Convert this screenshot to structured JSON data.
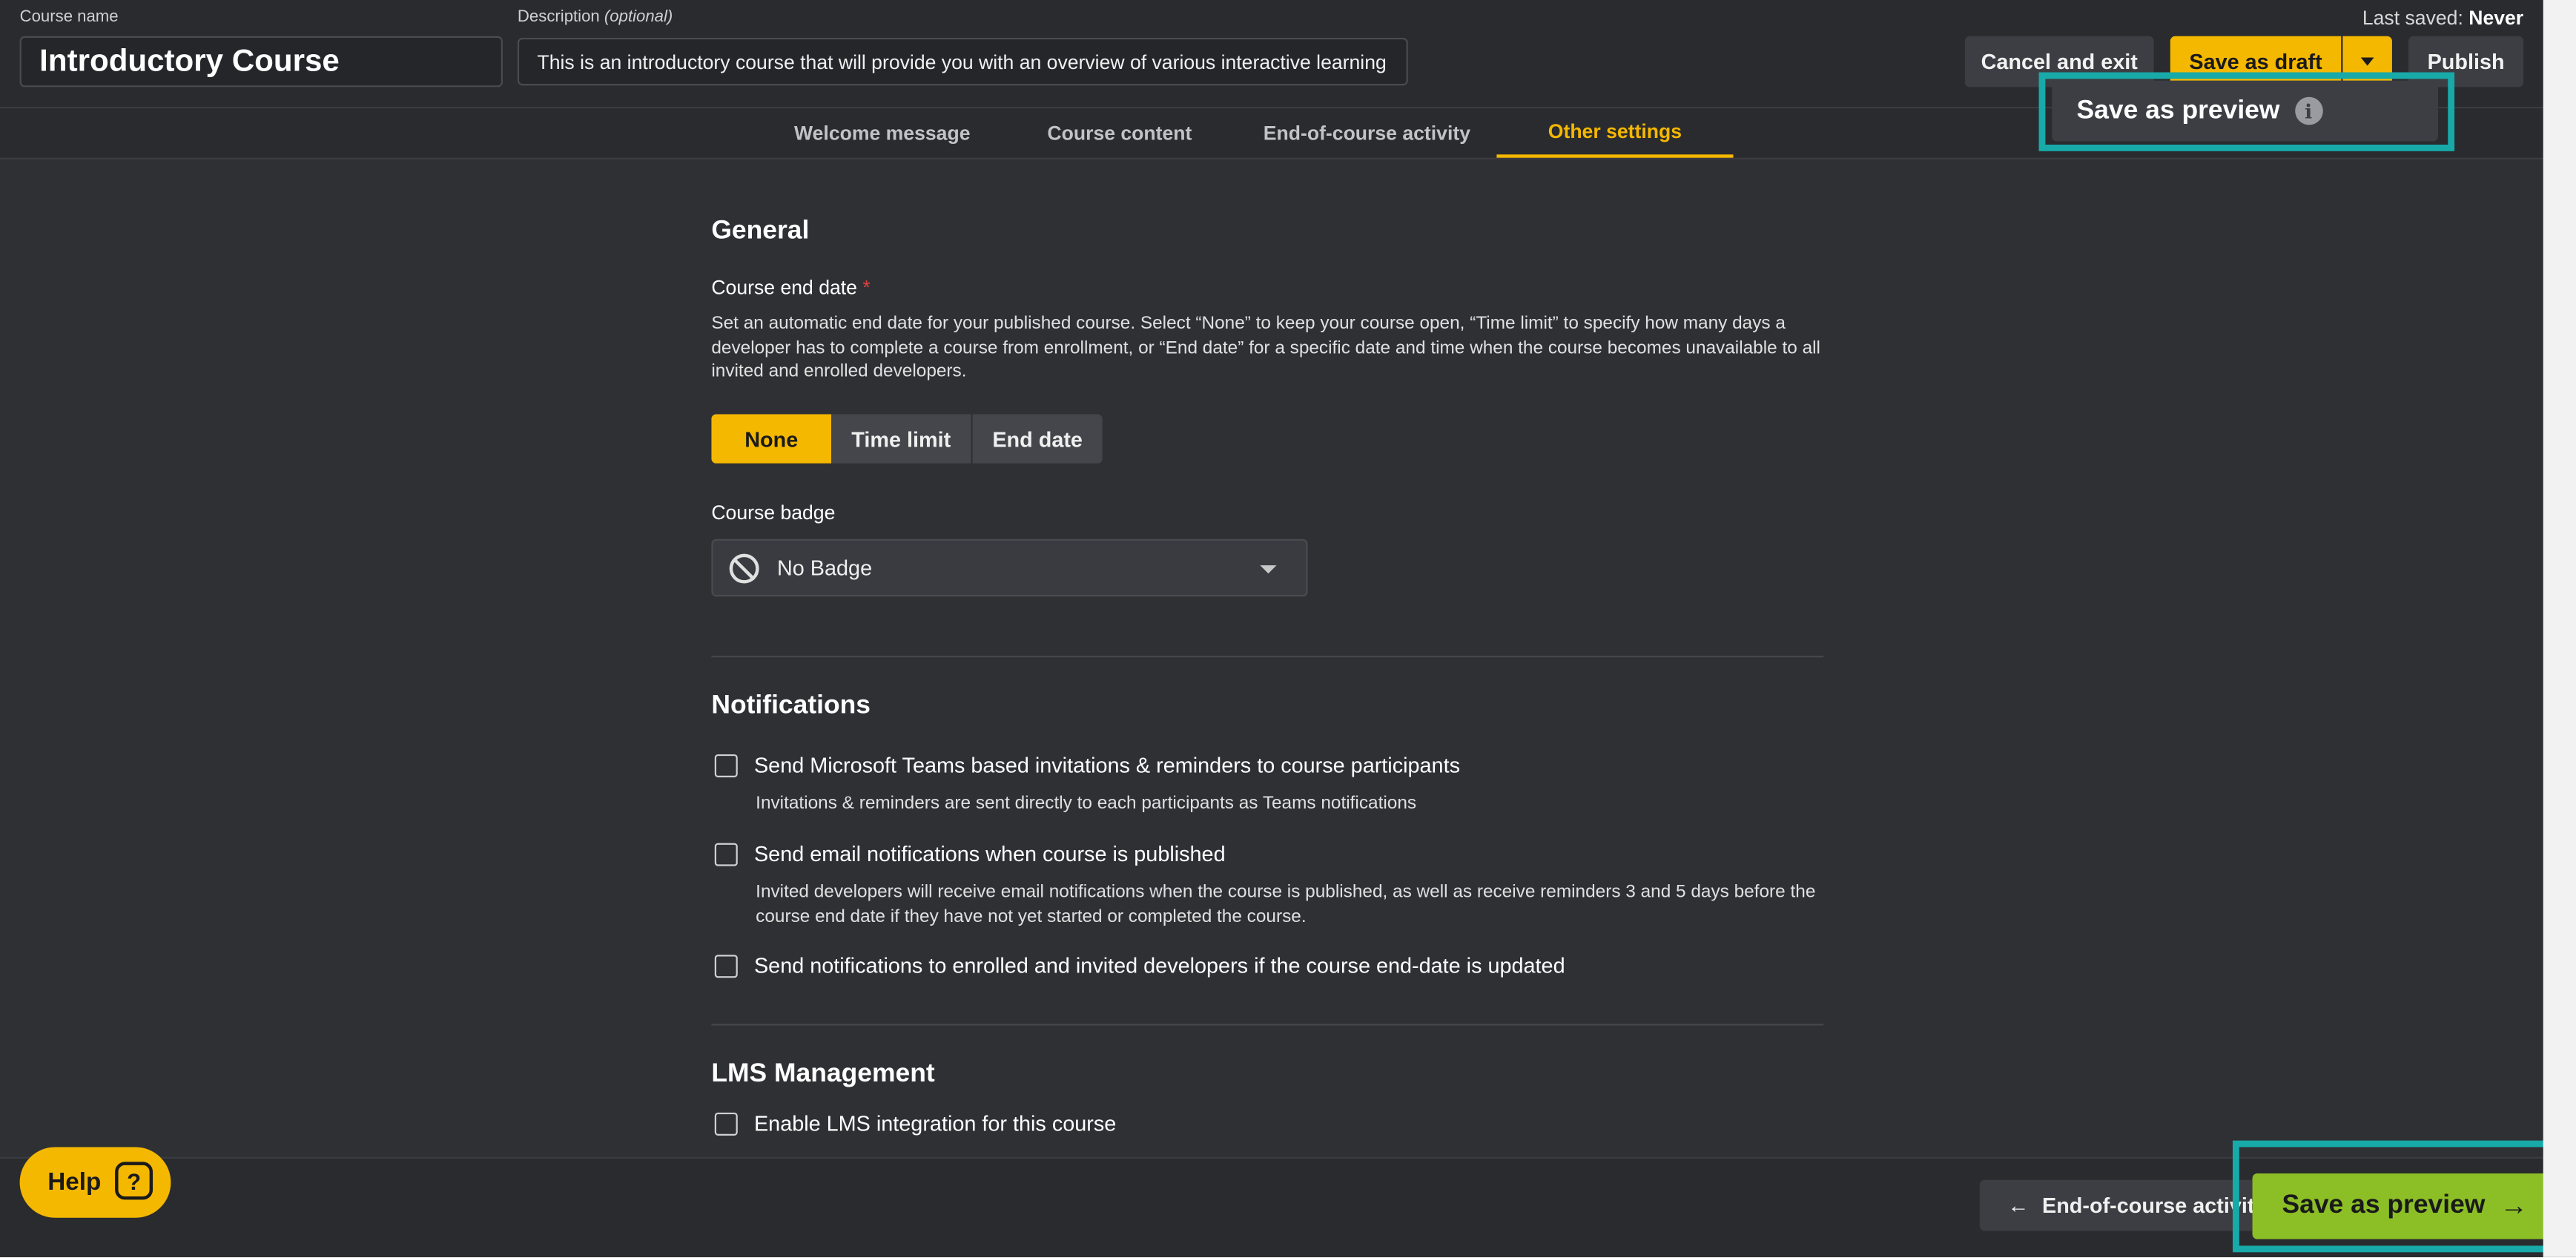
{
  "header": {
    "course_name_label": "Course name",
    "course_name_value": "Introductory Course",
    "description_label": "Description",
    "description_optional": "(optional)",
    "description_value": "This is an introductory course that will provide you with an overview of various interactive learning",
    "last_saved_label": "Last saved:",
    "last_saved_value": "Never",
    "cancel_label": "Cancel and exit",
    "save_draft_label": "Save as draft",
    "publish_label": "Publish",
    "dropdown_item_label": "Save as preview",
    "info_glyph": "i"
  },
  "tabs": [
    {
      "label": "Welcome message"
    },
    {
      "label": "Course content"
    },
    {
      "label": "End-of-course activity"
    },
    {
      "label": "Other settings"
    }
  ],
  "general": {
    "heading": "General",
    "end_date_label": "Course end date",
    "required_mark": "*",
    "end_date_help": "Set an automatic end date for your published course. Select “None” to keep your course open, “Time limit” to specify how many days a developer has to complete a course from enrollment, or “End date” for a specific date and time when the course becomes unavailable to all invited and enrolled developers.",
    "options": [
      "None",
      "Time limit",
      "End date"
    ],
    "badge_label": "Course badge",
    "badge_value": "No Badge"
  },
  "notifications": {
    "heading": "Notifications",
    "items": [
      {
        "label": "Send Microsoft Teams based invitations & reminders to course participants",
        "help": "Invitations & reminders are sent directly to each participants as Teams notifications"
      },
      {
        "label": "Send email notifications when course is published",
        "help": "Invited developers will receive email notifications when the course is published, as well as receive reminders 3 and 5 days before the course end date if they have not yet started or completed the course."
      },
      {
        "label": "Send notifications to enrolled and invited developers if the course end-date is updated",
        "help": ""
      }
    ]
  },
  "lms": {
    "heading": "LMS Management",
    "enable_label": "Enable LMS integration for this course"
  },
  "footer": {
    "help_label": "Help",
    "help_glyph": "?",
    "back_label": "End-of-course activity",
    "back_glyph": "←",
    "preview_label": "Save as preview",
    "preview_glyph": "→"
  },
  "colors": {
    "accent": "#f5b800",
    "preview_green": "#8cbf26",
    "highlight": "#18a9a9"
  }
}
